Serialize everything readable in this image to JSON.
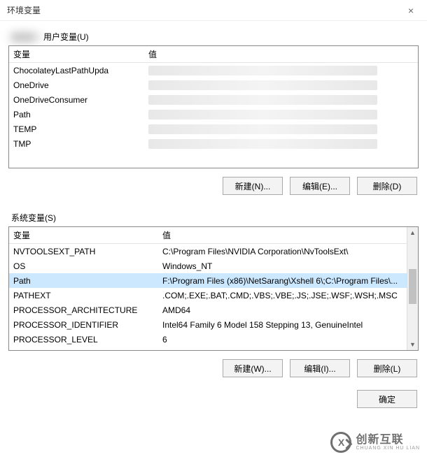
{
  "window": {
    "title": "环境变量",
    "close_icon": "×"
  },
  "user_section": {
    "label": "用户变量(U)",
    "prefix_blur": "的",
    "headers": {
      "variable": "变量",
      "value": "值"
    },
    "rows": [
      {
        "name": "ChocolateyLastPathUpda",
        "value_hidden": true
      },
      {
        "name": "OneDrive",
        "value_hidden": true
      },
      {
        "name": "OneDriveConsumer",
        "value_hidden": true
      },
      {
        "name": "Path",
        "value_hidden": true
      },
      {
        "name": "TEMP",
        "value_hidden": true
      },
      {
        "name": "TMP",
        "value_hidden": true
      }
    ],
    "buttons": {
      "new": "新建(N)...",
      "edit": "编辑(E)...",
      "delete": "删除(D)"
    }
  },
  "system_section": {
    "label": "系统变量(S)",
    "headers": {
      "variable": "变量",
      "value": "值"
    },
    "rows": [
      {
        "name": "NVTOOLSEXT_PATH",
        "value": "C:\\Program Files\\NVIDIA Corporation\\NvToolsExt\\"
      },
      {
        "name": "OS",
        "value": "Windows_NT"
      },
      {
        "name": "Path",
        "value": "F:\\Program Files (x86)\\NetSarang\\Xshell 6\\;C:\\Program Files\\...",
        "selected": true
      },
      {
        "name": "PATHEXT",
        "value": ".COM;.EXE;.BAT;.CMD;.VBS;.VBE;.JS;.JSE;.WSF;.WSH;.MSC"
      },
      {
        "name": "PROCESSOR_ARCHITECTURE",
        "value": "AMD64"
      },
      {
        "name": "PROCESSOR_IDENTIFIER",
        "value": "Intel64 Family 6 Model 158 Stepping 13, GenuineIntel"
      },
      {
        "name": "PROCESSOR_LEVEL",
        "value": "6"
      }
    ],
    "buttons": {
      "new": "新建(W)...",
      "edit": "编辑(I)...",
      "delete": "删除(L)"
    }
  },
  "footer": {
    "ok": "确定"
  },
  "watermark": {
    "logo_text": "X",
    "cn": "创新互联",
    "en": "CHUANG XIN HU LIAN"
  }
}
